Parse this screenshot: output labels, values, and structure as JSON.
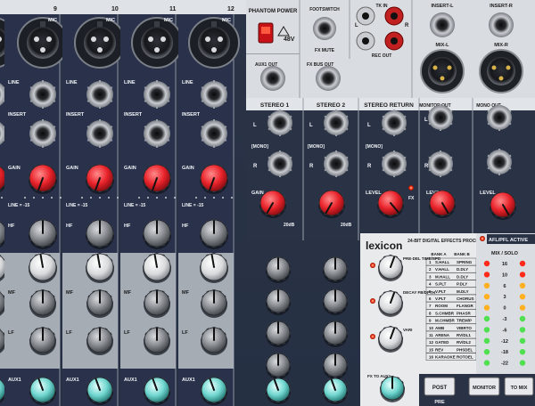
{
  "channels": {
    "numbers": [
      "9",
      "10",
      "11",
      "12"
    ],
    "mic_label": "MIC",
    "line_label": "LINE",
    "insert_label": "INSERT",
    "gain_label": "GAIN",
    "pad_label": "LINE = -15",
    "hf_label": "HF",
    "mf_label": "MF",
    "lf_label": "LF",
    "aux_label": "AUX1"
  },
  "master": {
    "phantom_power": "PHANTOM POWER",
    "phantom_voltage": "48V",
    "footswitch": "FOOTSWITCH",
    "fx_mute": "FX MUTE",
    "tk_in": "TK IN",
    "rec_out": "REC OUT",
    "left": "L",
    "right": "R",
    "insert_l": "INSERT-L",
    "insert_r": "INSERT-R",
    "mix_l": "MIX-L",
    "mix_r": "MIX-R",
    "aux1_out": "AUX1 OUT",
    "fx_bus_out": "FX BUS OUT",
    "stereo1": "STEREO 1",
    "stereo2": "STEREO 2",
    "stereo_return": "STEREO RETURN",
    "monitor_out": "MONITOR OUT",
    "mono_out": "MONO OUT",
    "mono_tag": "[MONO]",
    "level": "LEVEL",
    "fx_peak": "FX",
    "gain_db": "20dB",
    "afl_pfl": "AFL/PFL ACTIVE"
  },
  "fx": {
    "brand": "lexicon",
    "title": "24-BIT DIGITAL EFFECTS PROCESSOR",
    "bank_a": "BANK A",
    "bank_b": "BANK B",
    "pre_del": "PRE-DEL TIME/SPD",
    "decay": "DECAY FB/DPTH",
    "vari": "VARI",
    "to_aux": "FX TO AUX1",
    "programs": [
      [
        "1",
        "S.HALL",
        "SPRING"
      ],
      [
        "2",
        "V.HALL",
        "D.DLY"
      ],
      [
        "3",
        "M.HALL",
        "D.DLY"
      ],
      [
        "4",
        "S.PLT",
        "P.DLY"
      ],
      [
        "5",
        "V.PLT",
        "M.DLY"
      ],
      [
        "6",
        "V.PLT",
        "CHORUS"
      ],
      [
        "7",
        "ROOM",
        "FLANGR"
      ],
      [
        "8",
        "S.CHMBR",
        "PHASR"
      ],
      [
        "9",
        "M.CHMBR",
        "TREM/P"
      ],
      [
        "10",
        "AMB",
        "VIBRTO"
      ],
      [
        "11",
        "ARENA",
        "RV/DL1"
      ],
      [
        "12",
        "GATED",
        "RV/DL2"
      ],
      [
        "15",
        "REV",
        "PHSDEL"
      ],
      [
        "16",
        "KARAOKE",
        "ROTOEL"
      ]
    ]
  },
  "meter": {
    "title": "MIX / SOLO",
    "scale": [
      "16",
      "10",
      "6",
      "3",
      "0",
      "-3",
      "-6",
      "-12",
      "-18",
      "-22"
    ]
  },
  "buttons": {
    "post": "POST",
    "pre": "PRE",
    "monitor": "MONITOR",
    "to_mix": "TO MIX"
  }
}
